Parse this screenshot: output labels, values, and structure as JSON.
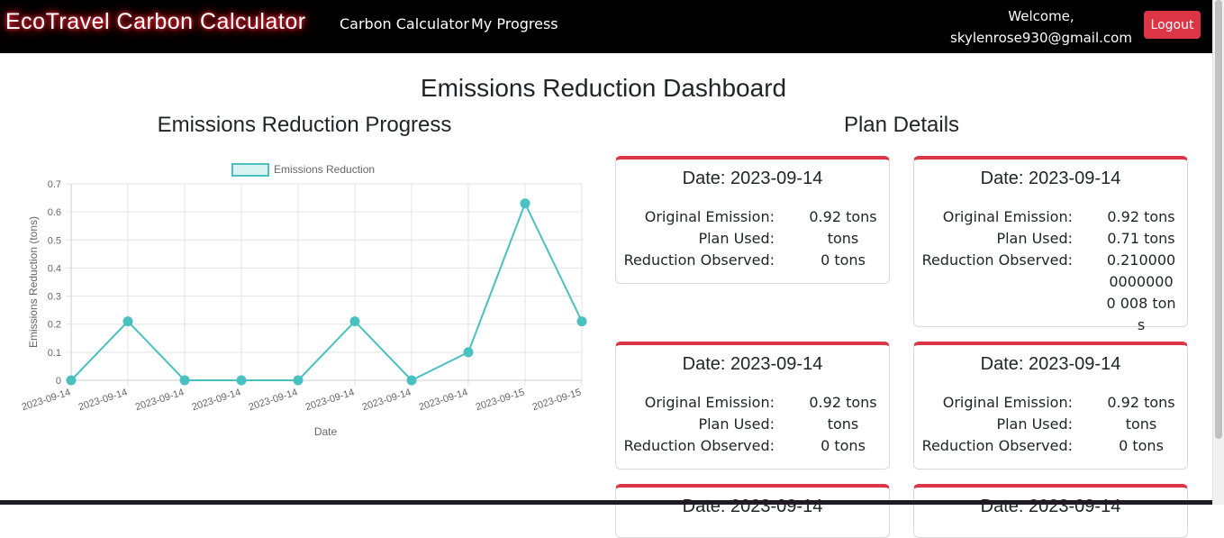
{
  "navbar": {
    "brand": "EcoTravel Carbon Calculator",
    "links": [
      "Carbon Calculator",
      "My Progress"
    ],
    "welcome_line1": "Welcome,",
    "welcome_line2": "skylenrose930@gmail.com",
    "logout_label": "Logout"
  },
  "page": {
    "title": "Emissions Reduction Dashboard",
    "chart_section_title": "Emissions Reduction Progress",
    "plan_section_title": "Plan Details"
  },
  "chart_data": {
    "type": "line",
    "title": "",
    "xlabel": "Date",
    "ylabel": "Emissions Reduction (tons)",
    "legend": "Emissions Reduction",
    "legend_position": "top",
    "grid": true,
    "ylim": [
      0,
      0.7
    ],
    "yticks": [
      "0",
      "0.1",
      "0.2",
      "0.3",
      "0.4",
      "0.5",
      "0.6",
      "0.7"
    ],
    "x": [
      "2023-09-14",
      "2023-09-14",
      "2023-09-14",
      "2023-09-14",
      "2023-09-14",
      "2023-09-14",
      "2023-09-14",
      "2023-09-14",
      "2023-09-15",
      "2023-09-15"
    ],
    "series": [
      {
        "name": "Emissions Reduction",
        "values": [
          0,
          0.21,
          0,
          0,
          0,
          0.21,
          0,
          0.1,
          0.63,
          0.21
        ]
      }
    ],
    "colors": {
      "line": "#4bc0c0",
      "fill": "#d8f1f1"
    }
  },
  "plans": [
    {
      "date": "Date: 2023-09-14",
      "original_label": "Original Emission:",
      "original_value": "0.92 tons",
      "plan_label": "Plan Used:",
      "plan_value": "tons",
      "reduction_label": "Reduction Observed:",
      "reduction_value": "0 tons"
    },
    {
      "date": "Date: 2023-09-14",
      "original_label": "Original Emission:",
      "original_value": "0.92 tons",
      "plan_label": "Plan Used:",
      "plan_value": "0.71 tons",
      "reduction_label": "Reduction Observed:",
      "reduction_value": "0.210000 00000000 008 tons"
    },
    {
      "date": "Date: 2023-09-14",
      "original_label": "Original Emission:",
      "original_value": "0.92 tons",
      "plan_label": "Plan Used:",
      "plan_value": "tons",
      "reduction_label": "Reduction Observed:",
      "reduction_value": "0 tons"
    },
    {
      "date": "Date: 2023-09-14",
      "original_label": "Original Emission:",
      "original_value": "0.92 tons",
      "plan_label": "Plan Used:",
      "plan_value": "tons",
      "reduction_label": "Reduction Observed:",
      "reduction_value": "0 tons"
    },
    {
      "date": "Date: 2023-09-14"
    },
    {
      "date": "Date: 2023-09-14"
    }
  ],
  "colors": {
    "navbar": "#000000",
    "logout": "#dc3545",
    "card_accent": "#dc3545"
  }
}
